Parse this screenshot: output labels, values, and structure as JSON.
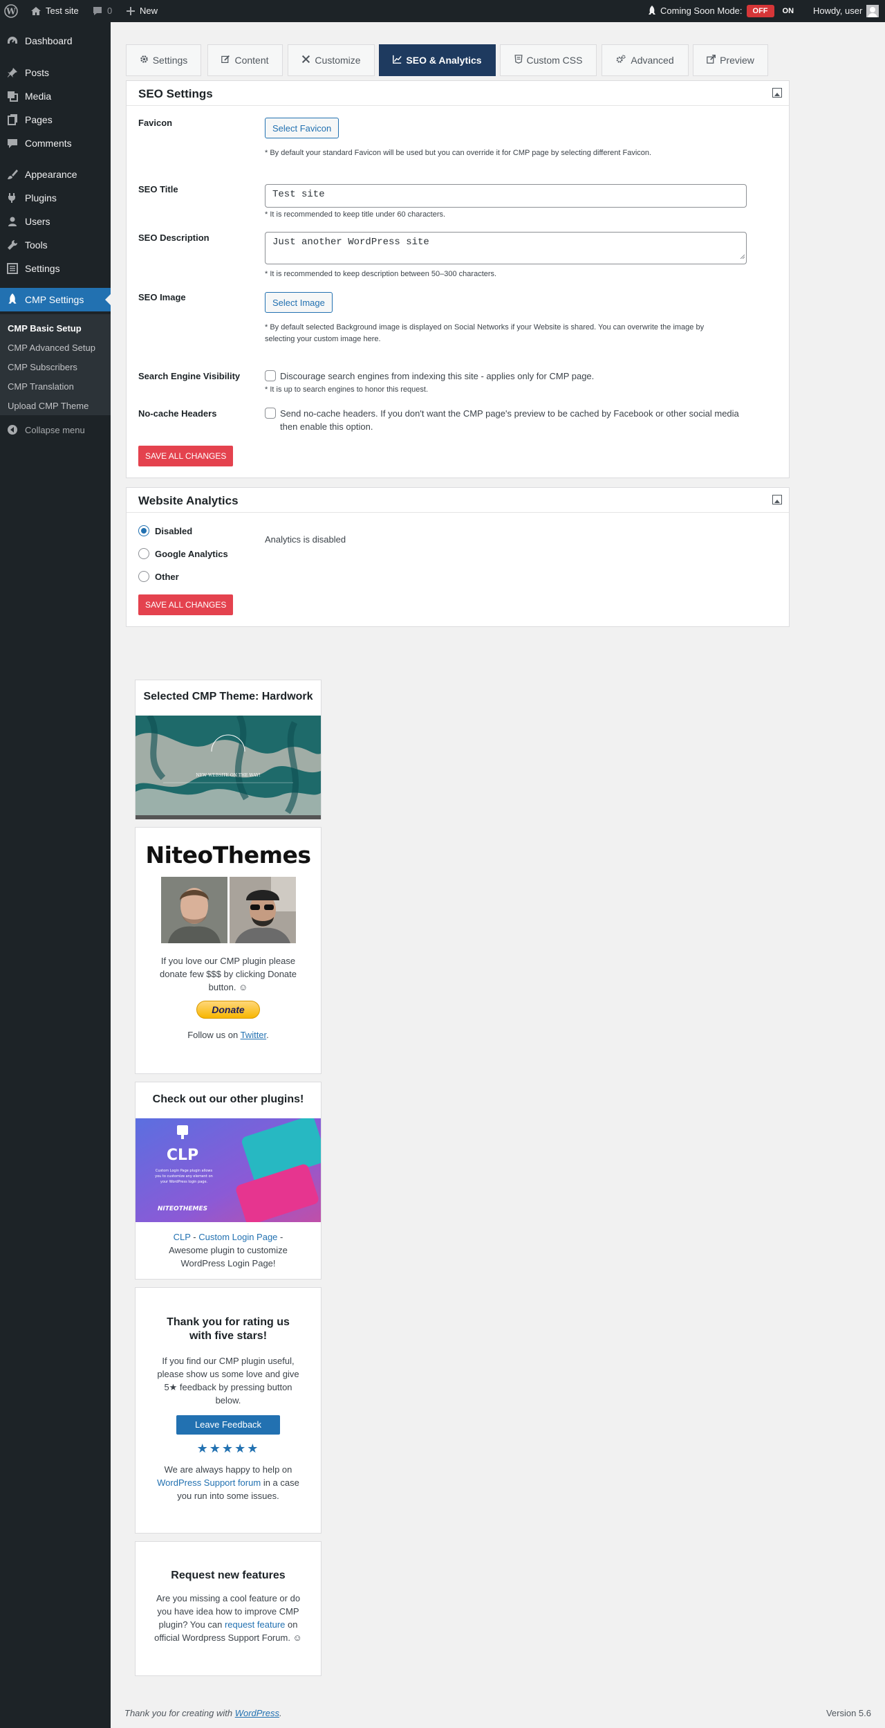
{
  "adminbar": {
    "site_name": "Test site",
    "comments_count": "0",
    "new_label": "New",
    "coming_soon_label": "Coming Soon Mode:",
    "toggle_off": "OFF",
    "toggle_on": "ON",
    "howdy": "Howdy, user"
  },
  "sidebar": {
    "items": [
      {
        "label": "Dashboard",
        "icon": "dashboard-icon"
      },
      {
        "label": "Posts",
        "icon": "pin-icon"
      },
      {
        "label": "Media",
        "icon": "media-icon"
      },
      {
        "label": "Pages",
        "icon": "pages-icon"
      },
      {
        "label": "Comments",
        "icon": "comment-icon"
      },
      {
        "label": "Appearance",
        "icon": "brush-icon"
      },
      {
        "label": "Plugins",
        "icon": "plug-icon"
      },
      {
        "label": "Users",
        "icon": "user-icon"
      },
      {
        "label": "Tools",
        "icon": "wrench-icon"
      },
      {
        "label": "Settings",
        "icon": "settings-icon"
      },
      {
        "label": "CMP Settings",
        "icon": "rocket-icon"
      }
    ],
    "submenu": [
      "CMP Basic Setup",
      "CMP Advanced Setup",
      "CMP Subscribers",
      "CMP Translation",
      "Upload CMP Theme"
    ],
    "collapse": "Collapse menu"
  },
  "tabs": [
    {
      "label": "Settings",
      "icon": "gear-icon"
    },
    {
      "label": "Content",
      "icon": "edit-icon"
    },
    {
      "label": "Customize",
      "icon": "tools-icon"
    },
    {
      "label": "SEO & Analytics",
      "icon": "chart-icon"
    },
    {
      "label": "Custom CSS",
      "icon": "css3-icon"
    },
    {
      "label": "Advanced",
      "icon": "gears-icon"
    },
    {
      "label": "Preview",
      "icon": "external-link-icon"
    }
  ],
  "seo": {
    "title": "SEO Settings",
    "favicon_label": "Favicon",
    "favicon_button": "Select Favicon",
    "favicon_note": "* By default your standard Favicon will be used but you can override it for CMP page by selecting different Favicon.",
    "seo_title_label": "SEO Title",
    "seo_title_value": "Test site",
    "seo_title_note": "* It is recommended to keep title under 60 characters.",
    "seo_desc_label": "SEO Description",
    "seo_desc_value": "Just another WordPress site",
    "seo_desc_note": "* It is recommended to keep description between 50–300 characters.",
    "seo_image_label": "SEO Image",
    "seo_image_button": "Select Image",
    "seo_image_note_1": "* By default selected Background image is displayed on Social Networks if your Website is shared. You can overwrite the image by",
    "seo_image_note_2": "selecting your custom image here.",
    "visibility_label": "Search Engine Visibility",
    "visibility_text": "Discourage search engines from indexing this site - applies only for CMP page.",
    "visibility_note": "* It is up to search engines to honor this request.",
    "nocache_label": "No-cache Headers",
    "nocache_text_1": "Send no-cache headers. If you don't want the CMP page's preview to be cached by Facebook or other social media",
    "nocache_text_2": "then enable this option.",
    "save": "SAVE ALL CHANGES"
  },
  "analytics": {
    "title": "Website Analytics",
    "options": [
      "Disabled",
      "Google Analytics",
      "Other"
    ],
    "selected": "Disabled",
    "status": "Analytics is disabled",
    "save": "SAVE ALL CHANGES"
  },
  "widgets": {
    "theme_title": "Selected CMP Theme: Hardwork",
    "theme_preview_text": "NEW WEBSITE ON THE WAY!",
    "niteo_logo": "NiteoThemes",
    "donate_text_1": "If you love our CMP plugin please",
    "donate_text_2": "donate few $$$ by clicking Donate",
    "donate_text_3": "button. ☺",
    "donate_button": "Donate",
    "follow_text": "Follow us on",
    "twitter": "Twitter",
    "plugins_title": "Check out our other plugins!",
    "clp_logo": "CLP",
    "clp_banner_text": "Custom Login Page plugin allows you to customize any element on your WordPress login page.",
    "clp_brand": "NITEOTHEMES",
    "clp_link_1": "CLP",
    "clp_link_2": "Custom Login Page",
    "clp_desc_1": "Awesome plugin to customize",
    "clp_desc_2": "WordPress Login Page!",
    "rating_title_1": "Thank you for rating us",
    "rating_title_2": "with five stars!",
    "rating_text_1": "If you find our CMP plugin useful,",
    "rating_text_2": "please show us some love and give",
    "rating_text_3": "5★ feedback by pressing button",
    "rating_text_4": "below.",
    "feedback_button": "Leave Feedback",
    "stars": "★★★★★",
    "help_text_1": "We are always happy to help on",
    "help_link": "WordPress Support forum",
    "help_text_2": "in a case",
    "help_text_3": "you run into some issues.",
    "request_title": "Request new features",
    "request_text_1": "Are you missing a cool feature or do",
    "request_text_2": "you have idea how to improve CMP",
    "request_text_3a": "plugin? You can",
    "request_link": "request feature",
    "request_text_3b": "on",
    "request_text_4": "official Wordpress Support Forum. ☺"
  },
  "footer": {
    "thanks": "Thank you for creating with",
    "wordpress": "WordPress",
    "version": "Version 5.6"
  }
}
